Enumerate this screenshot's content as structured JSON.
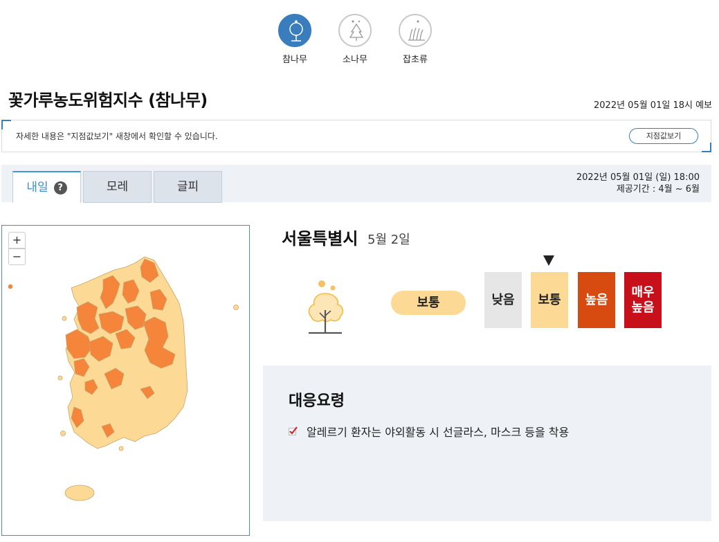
{
  "plants": [
    {
      "label": "참나무",
      "icon": "oak-tree-icon",
      "active": true
    },
    {
      "label": "소나무",
      "icon": "pine-tree-icon",
      "active": false
    },
    {
      "label": "잡초류",
      "icon": "weeds-icon",
      "active": false
    }
  ],
  "page": {
    "title": "꽃가루농도위험지수 (참나무)",
    "forecast_time": "2022년 05월 01일 18시 예보"
  },
  "info": {
    "text": "자세한 내용은 \"지점값보기\" 새창에서 확인할 수 있습니다.",
    "button": "지점값보기"
  },
  "tabs": [
    {
      "label": "내일",
      "active": true
    },
    {
      "label": "모레",
      "active": false
    },
    {
      "label": "글피",
      "active": false
    }
  ],
  "tab_info": {
    "date": "2022년 05월 01일 (일) 18:00",
    "period": "제공기간 : 4월 ~ 6월"
  },
  "map": {
    "zoom_in": "+",
    "zoom_out": "−",
    "colors": {
      "moderate": "#fcd995",
      "high": "#f4853a",
      "border": "#c7a56a"
    }
  },
  "region": {
    "name": "서울특별시",
    "date": "5월 2일",
    "level": "보통"
  },
  "levels": [
    {
      "label": "낮음",
      "color": "#e6e6e6"
    },
    {
      "label": "보통",
      "color": "#fcd995"
    },
    {
      "label": "높음",
      "color": "#d74b10"
    },
    {
      "label": "매우\n높음",
      "color": "#c8101a"
    }
  ],
  "current_level_index": 1,
  "guide": {
    "title": "대응요령",
    "items": [
      "알레르기 환자는 야외활동 시 선글라스, 마스크 등을 착용"
    ]
  }
}
